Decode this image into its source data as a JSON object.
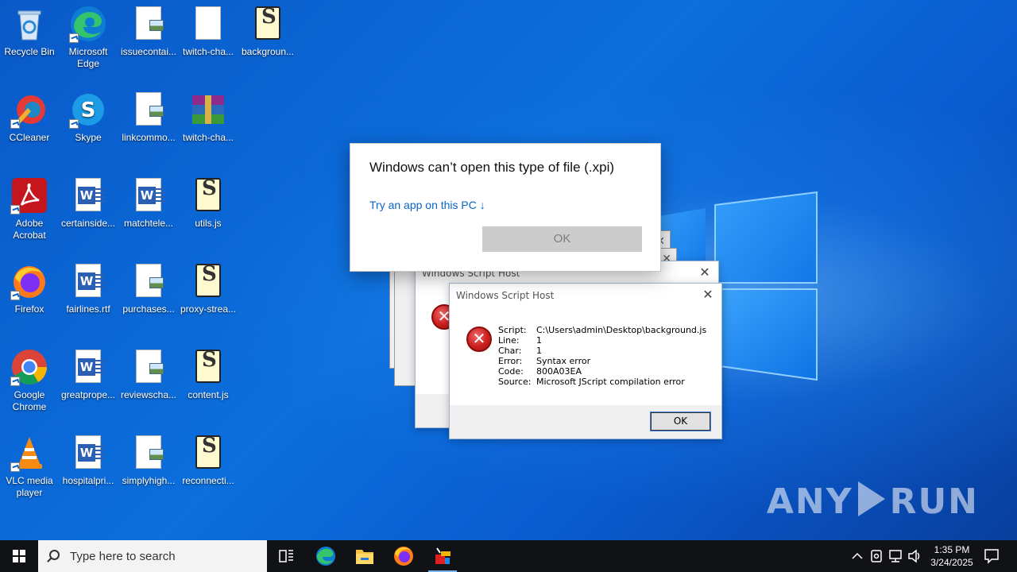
{
  "desktop": {
    "icons": [
      {
        "label": "Recycle Bin",
        "icon": "recycle-bin-icon"
      },
      {
        "label": "Microsoft Edge",
        "icon": "edge-icon"
      },
      {
        "label": "issuecontai...",
        "icon": "image-file-icon"
      },
      {
        "label": "twitch-cha...",
        "icon": "blank-file-icon"
      },
      {
        "label": "backgroun...",
        "icon": "script-file-icon"
      },
      {
        "label": "CCleaner",
        "icon": "ccleaner-icon"
      },
      {
        "label": "Skype",
        "icon": "skype-icon"
      },
      {
        "label": "linkcommo...",
        "icon": "image-file-icon"
      },
      {
        "label": "twitch-cha...",
        "icon": "winrar-archive-icon"
      },
      {
        "label": "Adobe Acrobat",
        "icon": "acrobat-icon"
      },
      {
        "label": "certainside...",
        "icon": "word-file-icon"
      },
      {
        "label": "matchtele...",
        "icon": "word-file-icon"
      },
      {
        "label": "utils.js",
        "icon": "script-file-icon"
      },
      {
        "label": "Firefox",
        "icon": "firefox-icon"
      },
      {
        "label": "fairlines.rtf",
        "icon": "word-file-icon"
      },
      {
        "label": "purchases...",
        "icon": "image-file-icon"
      },
      {
        "label": "proxy-strea...",
        "icon": "script-file-icon"
      },
      {
        "label": "Google Chrome",
        "icon": "chrome-icon"
      },
      {
        "label": "greatprope...",
        "icon": "word-file-icon"
      },
      {
        "label": "reviewscha...",
        "icon": "image-file-icon"
      },
      {
        "label": "content.js",
        "icon": "script-file-icon"
      },
      {
        "label": "VLC media player",
        "icon": "vlc-icon"
      },
      {
        "label": "hospitalpri...",
        "icon": "word-file-icon"
      },
      {
        "label": "simplyhigh...",
        "icon": "image-file-icon"
      },
      {
        "label": "reconnecti...",
        "icon": "script-file-icon"
      }
    ],
    "watermark": "ANY RUN"
  },
  "open_with_dialog": {
    "heading": "Windows can’t open this type of file (.xpi)",
    "link": "Try an app on this PC ↓",
    "ok_label": "OK"
  },
  "wsh_back": {
    "title": "Windows Script Host"
  },
  "wsh_front": {
    "title": "Windows Script Host",
    "fields": [
      {
        "key": "Script:",
        "value": "C:\\Users\\admin\\Desktop\\background.js"
      },
      {
        "key": "Line:",
        "value": "1"
      },
      {
        "key": "Char:",
        "value": "1"
      },
      {
        "key": "Error:",
        "value": "Syntax error"
      },
      {
        "key": "Code:",
        "value": "800A03EA"
      },
      {
        "key": "Source:",
        "value": "Microsoft JScript compilation error"
      }
    ],
    "ok_label": "OK"
  },
  "taskbar": {
    "search_placeholder": "Type here to search",
    "pinned": [
      "task-view-icon",
      "edge-icon",
      "file-explorer-icon",
      "firefox-icon",
      "script-host-icon"
    ],
    "clock_time": "1:35 PM",
    "clock_date": "3/24/2025"
  }
}
